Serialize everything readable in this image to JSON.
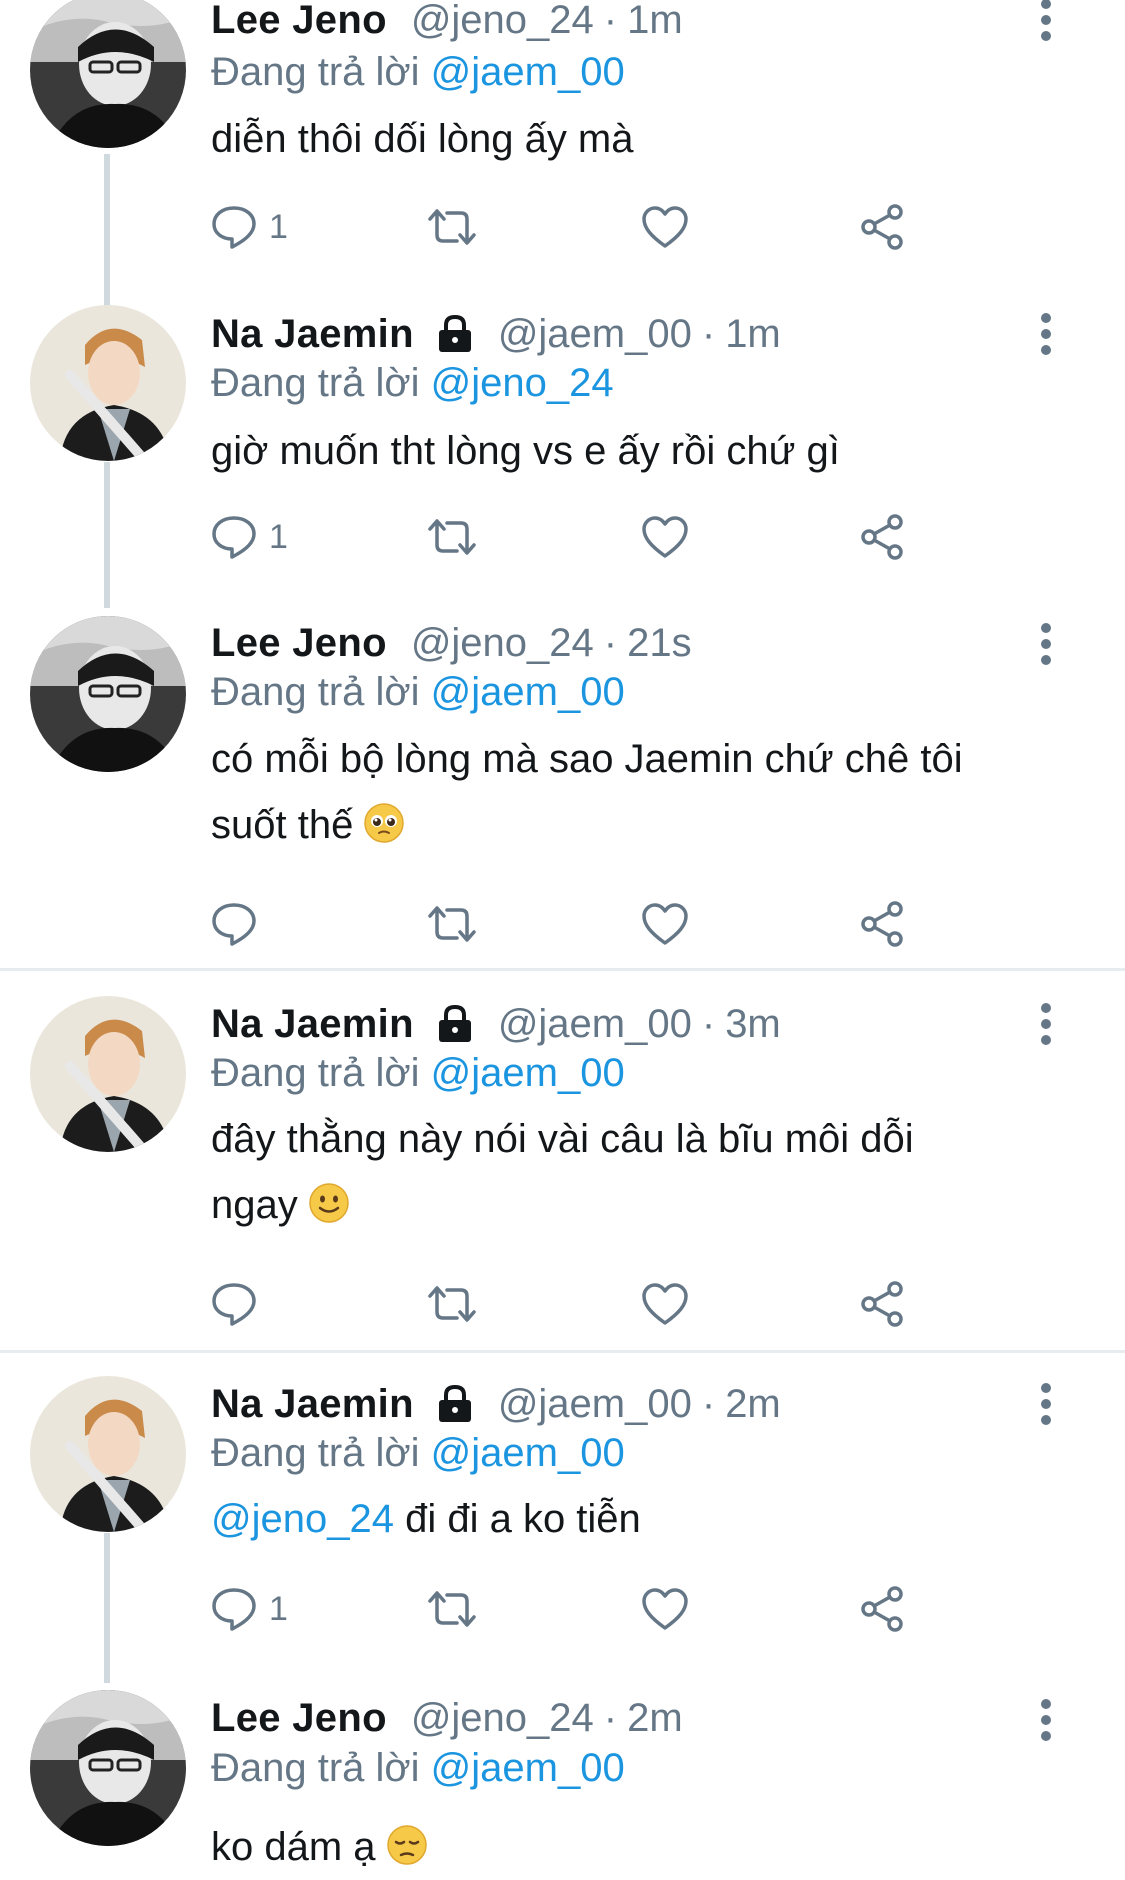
{
  "tweets": [
    {
      "name": "Lee Jeno",
      "verified_lock": false,
      "handle": "@jeno_24",
      "time": "1m",
      "replying_prefix": "Đang trả lời",
      "replying_to": "@jaem_00",
      "text": "diễn thôi dối lòng ấy mà",
      "text2": "",
      "mention": "",
      "reply_count": "1",
      "avatar": "jeno"
    },
    {
      "name": "Na Jaemin",
      "verified_lock": true,
      "handle": "@jaem_00",
      "time": "1m",
      "replying_prefix": "Đang trả lời",
      "replying_to": "@jeno_24",
      "text": "giờ muốn tht lòng vs e ấy rồi chứ gì",
      "text2": "",
      "mention": "",
      "reply_count": "1",
      "avatar": "jaemin"
    },
    {
      "name": "Lee Jeno",
      "verified_lock": false,
      "handle": "@jeno_24",
      "time": "21s",
      "replying_prefix": "Đang trả lời",
      "replying_to": "@jaem_00",
      "text": "có mỗi bộ lòng mà sao Jaemin chứ chê tôi",
      "text2": "suốt thế",
      "emoji": "pleading-face",
      "mention": "",
      "reply_count": "",
      "avatar": "jeno"
    },
    {
      "name": "Na Jaemin",
      "verified_lock": true,
      "handle": "@jaem_00",
      "time": "3m",
      "replying_prefix": "Đang trả lời",
      "replying_to": "@jaem_00",
      "text": "đây thằng này nói vài câu là bĩu môi dỗi",
      "text2": "ngay",
      "emoji": "slightly-smiling-face",
      "mention": "",
      "reply_count": "",
      "avatar": "jaemin"
    },
    {
      "name": "Na Jaemin",
      "verified_lock": true,
      "handle": "@jaem_00",
      "time": "2m",
      "replying_prefix": "Đang trả lời",
      "replying_to": "@jaem_00",
      "mention": "@jeno_24",
      "text": "đi đi a ko tiễn",
      "text2": "",
      "reply_count": "1",
      "avatar": "jaemin"
    },
    {
      "name": "Lee Jeno",
      "verified_lock": false,
      "handle": "@jeno_24",
      "time": "2m",
      "replying_prefix": "Đang trả lời",
      "replying_to": "@jaem_00",
      "text": "ko dám ạ",
      "text2": "",
      "emoji": "pensive-face",
      "mention": "",
      "reply_count": "",
      "avatar": "jeno"
    }
  ],
  "separator": "·",
  "colors": {
    "link": "#1b95e0",
    "secondary": "#657786",
    "divider": "#e6ecf0",
    "thread_line": "#cfd9de"
  },
  "icons": {
    "reply": "reply-icon",
    "retweet": "retweet-icon",
    "like": "heart-icon",
    "share": "share-icon",
    "more": "more-vertical-icon",
    "lock": "lock-icon"
  }
}
